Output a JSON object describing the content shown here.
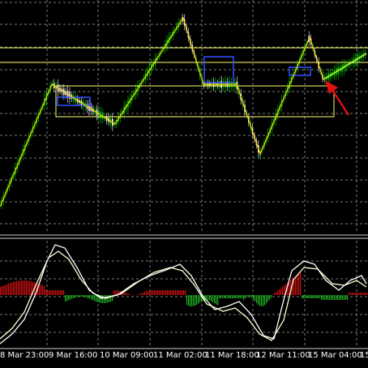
{
  "colors": {
    "background": "#000000",
    "grid": "#7a7a7a",
    "bull_candle": "#00d000",
    "bear_candle": "#ffffff",
    "zigzag": "#ffd000",
    "support_resistance": "#ffff70",
    "blue_box": "#3050ff",
    "histogram_positive": "#d01010",
    "histogram_negative": "#20b020",
    "oscillator_main": "#ffffff",
    "oscillator_signal": "#ffffd0",
    "arrow": "#e01010"
  },
  "x_axis": {
    "labels": [
      "8 Mar 23:00",
      "9 Mar 16:00",
      "10 Mar 09:00",
      "11 Mar 02:00",
      "11 Mar 18:00",
      "12 Mar 11:00",
      "15 Mar 04:00",
      "15"
    ]
  },
  "indicators": {
    "zigzag": true,
    "horizontal_levels": 2,
    "rectangle_zone": true,
    "oscillator_subwindow": true,
    "annotation_arrow": "red arrow pointing up-left"
  }
}
